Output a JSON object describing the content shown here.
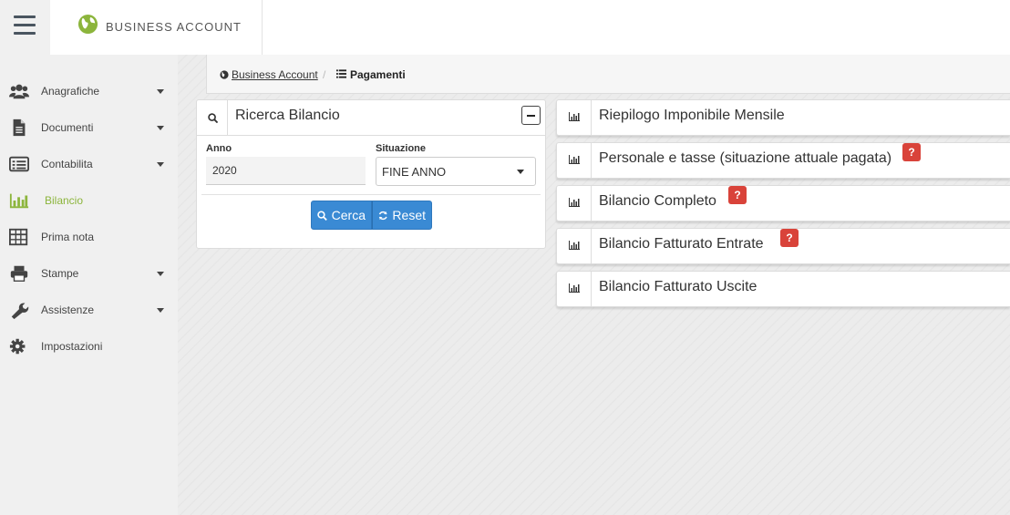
{
  "header": {
    "brand": "BUSINESS ACCOUNT",
    "menu_icon": "hamburger-menu-icon",
    "logo_icon": "globe-icon",
    "accent_color": "#8cb53c"
  },
  "sidebar": {
    "items": [
      {
        "label": "Anagrafiche",
        "icon": "users-icon",
        "has_submenu": true
      },
      {
        "label": "Documenti",
        "icon": "file-icon",
        "has_submenu": true
      },
      {
        "label": "Contabilita",
        "icon": "list-alt-icon",
        "has_submenu": true
      },
      {
        "label": "Bilancio",
        "icon": "bar-chart-icon",
        "has_submenu": false,
        "active": true
      },
      {
        "label": "Prima nota",
        "icon": "table-icon",
        "has_submenu": false
      },
      {
        "label": "Stampe",
        "icon": "print-icon",
        "has_submenu": true
      },
      {
        "label": "Assistenze",
        "icon": "wrench-icon",
        "has_submenu": true
      },
      {
        "label": "Impostazioni",
        "icon": "gear-icon",
        "has_submenu": false
      }
    ]
  },
  "breadcrumb": {
    "home": "Business Account",
    "separator": "/",
    "current": "Pagamenti"
  },
  "search_panel": {
    "title": "Ricerca Bilancio",
    "anno_label": "Anno",
    "anno_value": "2020",
    "situazione_label": "Situazione",
    "situazione_value": "FINE ANNO",
    "cerca_label": "Cerca",
    "reset_label": "Reset",
    "button_color": "#3a8ad4"
  },
  "reports": [
    {
      "title": "Riepilogo Imponibile Mensile",
      "help": false
    },
    {
      "title": "Personale e tasse (situazione attuale pagata)",
      "help": true
    },
    {
      "title": "Bilancio Completo",
      "help": true
    },
    {
      "title": "Bilancio Fatturato Entrate",
      "help": true
    },
    {
      "title": "Bilancio Fatturato Uscite",
      "help": false
    }
  ],
  "help_badge": {
    "text": "?",
    "color": "#d9433a"
  }
}
